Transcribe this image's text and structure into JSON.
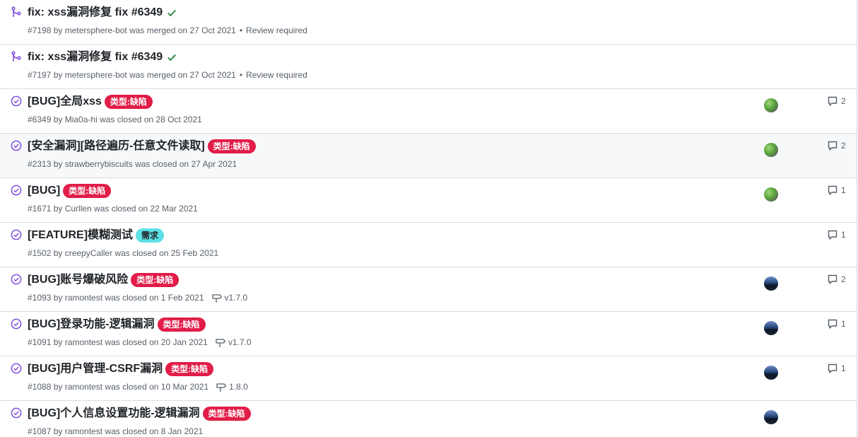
{
  "colors": {
    "merged": "#8250df",
    "closed": "#8250df",
    "check": "#1a7f37",
    "label_bug": "#e11d48",
    "label_req": "#5ce1e6",
    "muted": "#57606a"
  },
  "items": [
    {
      "type": "pr-merged",
      "title": "fix: xss漏洞修复 fix #6349",
      "meta": "#7198 by metersphere-bot was merged on 27 Oct 2021",
      "review": "Review required"
    },
    {
      "type": "pr-merged",
      "title": "fix: xss漏洞修复 fix #6349",
      "meta": "#7197 by metersphere-bot was merged on 27 Oct 2021",
      "review": "Review required"
    },
    {
      "type": "issue-closed",
      "title": "[BUG]全局xss",
      "label": "类型:缺陷",
      "meta": "#6349 by Mia0a-hi was closed on 28 Oct 2021",
      "avatar": "green",
      "comments": "2"
    },
    {
      "type": "issue-closed",
      "title": "[安全漏洞][路径遍历-任意文件读取]",
      "label": "类型:缺陷",
      "meta": "#2313 by strawberrybiscuits was closed on 27 Apr 2021",
      "avatar": "green",
      "comments": "2"
    },
    {
      "type": "issue-closed",
      "title": "[BUG]",
      "label": "类型:缺陷",
      "meta": "#1671 by Curllen was closed on 22 Mar 2021",
      "avatar": "green",
      "comments": "1"
    },
    {
      "type": "issue-closed",
      "title": "[FEATURE]模糊测试",
      "label": "需求",
      "meta": "#1502 by creepyCaller was closed on 25 Feb 2021",
      "comments": "1"
    },
    {
      "type": "issue-closed",
      "title": "[BUG]账号爆破风险",
      "label": "类型:缺陷",
      "meta": "#1093 by ramontest was closed on 1 Feb 2021",
      "milestone": "v1.7.0",
      "avatar": "blue",
      "comments": "2"
    },
    {
      "type": "issue-closed",
      "title": "[BUG]登录功能-逻辑漏洞",
      "label": "类型:缺陷",
      "meta": "#1091 by ramontest was closed on 20 Jan 2021",
      "milestone": "v1.7.0",
      "avatar": "blue",
      "comments": "1"
    },
    {
      "type": "issue-closed",
      "title": "[BUG]用户管理-CSRF漏洞",
      "label": "类型:缺陷",
      "meta": "#1088 by ramontest was closed on 10 Mar 2021",
      "milestone": "1.8.0",
      "avatar": "blue",
      "comments": "1"
    },
    {
      "type": "issue-closed",
      "title": "[BUG]个人信息设置功能-逻辑漏洞",
      "label": "类型:缺陷",
      "meta": "#1087 by ramontest was closed on 8 Jan 2021",
      "avatar": "blue"
    }
  ]
}
